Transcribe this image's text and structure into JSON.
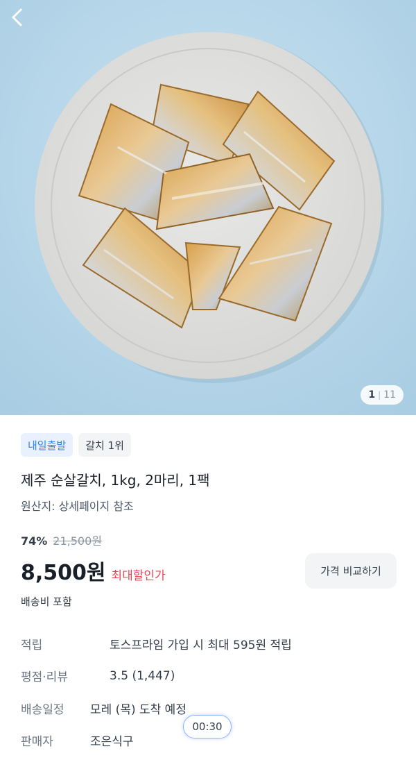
{
  "header": {
    "back_icon": "chevron-left-icon"
  },
  "gallery": {
    "current": "1",
    "total": "11"
  },
  "badges": [
    {
      "label": "내일출발",
      "color": "#3182f6"
    },
    {
      "label": "갈치 1위"
    }
  ],
  "product": {
    "title": "제주 순살갈치, 1kg, 2마리, 1팩",
    "origin": "원산지: 상세페이지 참조"
  },
  "pricing": {
    "discount_rate": "74%",
    "original_price": "21,500원",
    "price": "8,500원",
    "price_tag": "최대할인가",
    "price_tag_color": "#f04452",
    "compare_button": "가격 비교하기",
    "shipping": "배송비 포함"
  },
  "info": {
    "points": {
      "label": "적립",
      "value": "토스프라임 가입 시 최대 595원 적립"
    },
    "rating": {
      "label": "평점·리뷰",
      "value": "3.5 (1,447)"
    },
    "delivery": {
      "label": "배송일정",
      "value": "모레 (목) 도착 예정"
    },
    "seller": {
      "label": "판매자",
      "value": "조은식구"
    }
  },
  "timer": "00:30"
}
